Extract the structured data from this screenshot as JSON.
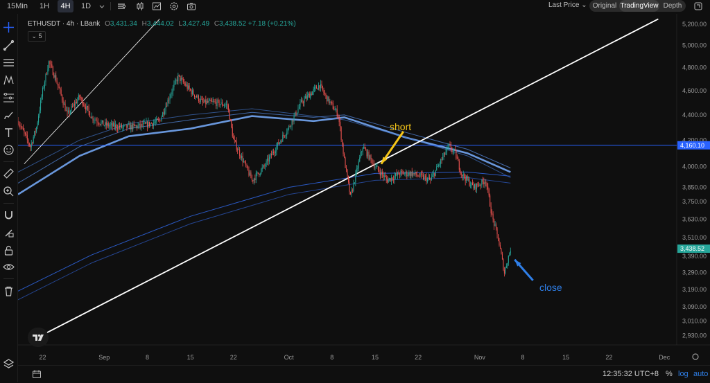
{
  "toolbar": {
    "timeframes": [
      {
        "label": "15Min",
        "active": false
      },
      {
        "label": "1H",
        "active": false
      },
      {
        "label": "4H",
        "active": true
      },
      {
        "label": "1D",
        "active": false
      }
    ],
    "price_source": "Last Price",
    "view_modes": [
      {
        "label": "Original",
        "active": false
      },
      {
        "label": "TradingView",
        "active": true
      },
      {
        "label": "Depth",
        "active": false
      }
    ]
  },
  "legend": {
    "symbol": "ETHUSDT · 4h · LBank",
    "open_label": "O",
    "open": "3,431.34",
    "high_label": "H",
    "high": "3,444.02",
    "low_label": "L",
    "low": "3,427.49",
    "close_label": "C",
    "close": "3,438.52",
    "change": "+7.18 (+0.21%)",
    "indicator_count": "5"
  },
  "annotations": {
    "short_label": "short",
    "close_label": "close",
    "short_color": "#f5c518",
    "close_color": "#2f7fe8"
  },
  "bottom": {
    "time": "12:35:32 UTC+8",
    "percent": "%",
    "log": "log",
    "auto": "auto"
  },
  "colors": {
    "up": "#26a69a",
    "down": "#ef5350",
    "accent": "#2962ff",
    "background": "#0f0f0f"
  },
  "chart_data": {
    "type": "candlestick",
    "symbol": "ETHUSDT",
    "interval": "4h",
    "y_scale": "log",
    "ylim": [
      2880,
      5300
    ],
    "yticks": [
      5200,
      5000,
      4800,
      4600,
      4400,
      4200,
      4000,
      3850,
      3750,
      3630,
      3510,
      3390,
      3290,
      3190,
      3090,
      3010,
      2930
    ],
    "ytick_labels": [
      "5,200.00",
      "5,000.00",
      "4,800.00",
      "4,600.00",
      "4,400.00",
      "4,200.00",
      "4,000.00",
      "3,850.00",
      "3,750.00",
      "3,630.00",
      "3,510.00",
      "3,390.00",
      "3,290.00",
      "3,190.00",
      "3,090.00",
      "3,010.00",
      "2,930.00"
    ],
    "xlim": [
      "2025-08-18",
      "2025-12-03"
    ],
    "xticks": [
      {
        "date": "2025-08-22",
        "label": "22"
      },
      {
        "date": "2025-09-01",
        "label": "Sep"
      },
      {
        "date": "2025-09-08",
        "label": "8"
      },
      {
        "date": "2025-09-15",
        "label": "15"
      },
      {
        "date": "2025-09-22",
        "label": "22"
      },
      {
        "date": "2025-10-01",
        "label": "Oct"
      },
      {
        "date": "2025-10-08",
        "label": "8"
      },
      {
        "date": "2025-10-15",
        "label": "15"
      },
      {
        "date": "2025-10-22",
        "label": "22"
      },
      {
        "date": "2025-11-01",
        "label": "Nov"
      },
      {
        "date": "2025-11-08",
        "label": "8"
      },
      {
        "date": "2025-11-15",
        "label": "15"
      },
      {
        "date": "2025-11-22",
        "label": "22"
      },
      {
        "date": "2025-12-01",
        "label": "Dec"
      }
    ],
    "price_path": [
      {
        "date": "2025-08-18",
        "price": 4350
      },
      {
        "date": "2025-08-20",
        "price": 4150
      },
      {
        "date": "2025-08-21",
        "price": 4300
      },
      {
        "date": "2025-08-22",
        "price": 4600
      },
      {
        "date": "2025-08-23",
        "price": 4850
      },
      {
        "date": "2025-08-24",
        "price": 4720
      },
      {
        "date": "2025-08-26",
        "price": 4400
      },
      {
        "date": "2025-08-28",
        "price": 4550
      },
      {
        "date": "2025-08-30",
        "price": 4380
      },
      {
        "date": "2025-09-01",
        "price": 4320
      },
      {
        "date": "2025-09-04",
        "price": 4300
      },
      {
        "date": "2025-09-07",
        "price": 4310
      },
      {
        "date": "2025-09-10",
        "price": 4350
      },
      {
        "date": "2025-09-12",
        "price": 4600
      },
      {
        "date": "2025-09-13",
        "price": 4720
      },
      {
        "date": "2025-09-15",
        "price": 4600
      },
      {
        "date": "2025-09-17",
        "price": 4500
      },
      {
        "date": "2025-09-19",
        "price": 4500
      },
      {
        "date": "2025-09-21",
        "price": 4480
      },
      {
        "date": "2025-09-22",
        "price": 4200
      },
      {
        "date": "2025-09-25",
        "price": 3900
      },
      {
        "date": "2025-09-27",
        "price": 4000
      },
      {
        "date": "2025-09-29",
        "price": 4150
      },
      {
        "date": "2025-10-01",
        "price": 4300
      },
      {
        "date": "2025-10-03",
        "price": 4500
      },
      {
        "date": "2025-10-06",
        "price": 4650
      },
      {
        "date": "2025-10-07",
        "price": 4550
      },
      {
        "date": "2025-10-09",
        "price": 4400
      },
      {
        "date": "2025-10-10",
        "price": 4050
      },
      {
        "date": "2025-10-11",
        "price": 3780
      },
      {
        "date": "2025-10-13",
        "price": 4150
      },
      {
        "date": "2025-10-15",
        "price": 4000
      },
      {
        "date": "2025-10-17",
        "price": 3900
      },
      {
        "date": "2025-10-19",
        "price": 3950
      },
      {
        "date": "2025-10-21",
        "price": 3950
      },
      {
        "date": "2025-10-24",
        "price": 3900
      },
      {
        "date": "2025-10-27",
        "price": 4150
      },
      {
        "date": "2025-10-28",
        "price": 4100
      },
      {
        "date": "2025-10-29",
        "price": 3950
      },
      {
        "date": "2025-10-31",
        "price": 3850
      },
      {
        "date": "2025-11-02",
        "price": 3900
      },
      {
        "date": "2025-11-03",
        "price": 3650
      },
      {
        "date": "2025-11-04",
        "price": 3500
      },
      {
        "date": "2025-11-05",
        "price": 3290
      },
      {
        "date": "2025-11-06",
        "price": 3438.52
      }
    ],
    "horizontal_line": {
      "price": 4160.1,
      "label": "4,160.10"
    },
    "last_price": {
      "price": 3438.52,
      "label": "3,438.52"
    },
    "trendlines": [
      {
        "from": {
          "date": "2025-08-19",
          "price": 4020
        },
        "to": {
          "date": "2025-09-10",
          "price": 5250
        }
      },
      {
        "from": {
          "date": "2025-08-20",
          "price": 2900
        },
        "to": {
          "date": "2025-11-30",
          "price": 5250
        }
      }
    ],
    "moving_averages": [
      {
        "points": [
          [
            "2025-08-18",
            3800
          ],
          [
            "2025-08-28",
            4080
          ],
          [
            "2025-09-05",
            4230
          ],
          [
            "2025-09-15",
            4290
          ],
          [
            "2025-09-25",
            4390
          ],
          [
            "2025-10-05",
            4350
          ],
          [
            "2025-10-10",
            4380
          ],
          [
            "2025-10-20",
            4220
          ],
          [
            "2025-10-30",
            4100
          ],
          [
            "2025-11-06",
            3960
          ]
        ]
      },
      {
        "points": [
          [
            "2025-08-18",
            3880
          ],
          [
            "2025-08-28",
            4150
          ],
          [
            "2025-09-05",
            4290
          ],
          [
            "2025-09-15",
            4360
          ],
          [
            "2025-09-25",
            4420
          ],
          [
            "2025-10-05",
            4380
          ],
          [
            "2025-10-10",
            4400
          ],
          [
            "2025-10-20",
            4260
          ],
          [
            "2025-10-30",
            4130
          ],
          [
            "2025-11-06",
            3990
          ]
        ]
      },
      {
        "points": [
          [
            "2025-08-18",
            3960
          ],
          [
            "2025-08-28",
            4200
          ],
          [
            "2025-09-05",
            4330
          ],
          [
            "2025-09-15",
            4400
          ],
          [
            "2025-09-25",
            4450
          ],
          [
            "2025-10-05",
            4390
          ],
          [
            "2025-10-10",
            4360
          ],
          [
            "2025-10-20",
            4220
          ],
          [
            "2025-10-30",
            4080
          ],
          [
            "2025-11-06",
            3920
          ]
        ]
      },
      {
        "points": [
          [
            "2025-08-18",
            3180
          ],
          [
            "2025-08-30",
            3400
          ],
          [
            "2025-09-15",
            3650
          ],
          [
            "2025-10-01",
            3850
          ],
          [
            "2025-10-15",
            3950
          ],
          [
            "2025-10-30",
            3960
          ],
          [
            "2025-11-06",
            3930
          ]
        ]
      },
      {
        "points": [
          [
            "2025-08-18",
            3130
          ],
          [
            "2025-08-30",
            3350
          ],
          [
            "2025-09-15",
            3600
          ],
          [
            "2025-10-01",
            3800
          ],
          [
            "2025-10-15",
            3900
          ],
          [
            "2025-10-30",
            3920
          ],
          [
            "2025-11-06",
            3880
          ]
        ]
      }
    ],
    "annotations": [
      {
        "text": "short",
        "date": "2025-10-16",
        "price": 4300
      },
      {
        "text": "close",
        "date": "2025-11-11",
        "price": 3260
      }
    ]
  }
}
